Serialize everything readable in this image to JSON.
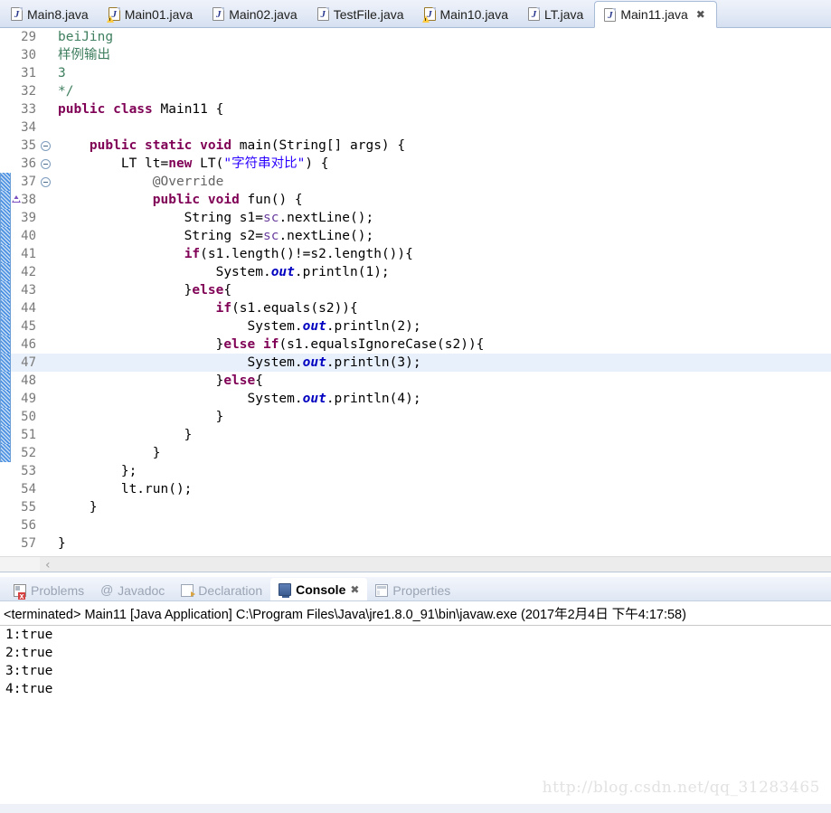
{
  "editor_tabs": [
    {
      "label": "Main8.java",
      "icon": "java-file-icon",
      "active": false,
      "warning": false
    },
    {
      "label": "Main01.java",
      "icon": "java-file-warning-icon",
      "active": false,
      "warning": true
    },
    {
      "label": "Main02.java",
      "icon": "java-file-icon",
      "active": false,
      "warning": false
    },
    {
      "label": "TestFile.java",
      "icon": "java-file-icon",
      "active": false,
      "warning": false
    },
    {
      "label": "Main10.java",
      "icon": "java-file-warning-icon",
      "active": false,
      "warning": true
    },
    {
      "label": "LT.java",
      "icon": "java-file-icon",
      "active": false,
      "warning": false
    },
    {
      "label": "Main11.java",
      "icon": "java-file-icon",
      "active": true,
      "warning": false,
      "close_glyph": "✖"
    }
  ],
  "code": {
    "lines": [
      {
        "no": "29",
        "indent": 0,
        "changed": false,
        "fold": false,
        "current": false,
        "tokens": [
          {
            "t": "beiJing",
            "c": "cmt"
          }
        ]
      },
      {
        "no": "30",
        "indent": 0,
        "changed": false,
        "fold": false,
        "current": false,
        "tokens": [
          {
            "t": "样例输出",
            "c": "cmt"
          }
        ]
      },
      {
        "no": "31",
        "indent": 0,
        "changed": false,
        "fold": false,
        "current": false,
        "tokens": [
          {
            "t": "3",
            "c": "cmt"
          }
        ]
      },
      {
        "no": "32",
        "indent": 0,
        "changed": false,
        "fold": false,
        "current": false,
        "tokens": [
          {
            "t": "*/",
            "c": "cmt"
          }
        ]
      },
      {
        "no": "33",
        "indent": 0,
        "changed": false,
        "fold": false,
        "current": false,
        "tokens": [
          {
            "t": "public class ",
            "c": "kw"
          },
          {
            "t": "Main11 {",
            "c": ""
          }
        ]
      },
      {
        "no": "34",
        "indent": 0,
        "changed": false,
        "fold": false,
        "current": false,
        "tokens": []
      },
      {
        "no": "35",
        "indent": 0,
        "changed": false,
        "fold": true,
        "current": false,
        "tokens": [
          {
            "t": "    ",
            "c": ""
          },
          {
            "t": "public static void ",
            "c": "kw"
          },
          {
            "t": "main(String[] args) {",
            "c": ""
          }
        ]
      },
      {
        "no": "36",
        "indent": 0,
        "changed": false,
        "fold": true,
        "current": false,
        "tokens": [
          {
            "t": "        LT lt=",
            "c": ""
          },
          {
            "t": "new ",
            "c": "kw"
          },
          {
            "t": "LT(",
            "c": ""
          },
          {
            "t": "\"字符串对比\"",
            "c": "str"
          },
          {
            "t": ") {",
            "c": ""
          }
        ]
      },
      {
        "no": "37",
        "indent": 0,
        "changed": true,
        "fold": true,
        "current": false,
        "tokens": [
          {
            "t": "            ",
            "c": ""
          },
          {
            "t": "@Override",
            "c": "ann"
          }
        ]
      },
      {
        "no": "38",
        "indent": 0,
        "changed": true,
        "fold": false,
        "current": false,
        "override": true,
        "tokens": [
          {
            "t": "            ",
            "c": ""
          },
          {
            "t": "public void ",
            "c": "kw"
          },
          {
            "t": "fun() {",
            "c": ""
          }
        ]
      },
      {
        "no": "39",
        "indent": 0,
        "changed": true,
        "fold": false,
        "current": false,
        "tokens": [
          {
            "t": "                String s1=",
            "c": ""
          },
          {
            "t": "sc",
            "c": "loc"
          },
          {
            "t": ".nextLine();",
            "c": ""
          }
        ]
      },
      {
        "no": "40",
        "indent": 0,
        "changed": true,
        "fold": false,
        "current": false,
        "tokens": [
          {
            "t": "                String s2=",
            "c": ""
          },
          {
            "t": "sc",
            "c": "loc"
          },
          {
            "t": ".nextLine();",
            "c": ""
          }
        ]
      },
      {
        "no": "41",
        "indent": 0,
        "changed": true,
        "fold": false,
        "current": false,
        "tokens": [
          {
            "t": "                ",
            "c": ""
          },
          {
            "t": "if",
            "c": "kw"
          },
          {
            "t": "(s1.length()!=s2.length()){",
            "c": ""
          }
        ]
      },
      {
        "no": "42",
        "indent": 0,
        "changed": true,
        "fold": false,
        "current": false,
        "tokens": [
          {
            "t": "                    System.",
            "c": ""
          },
          {
            "t": "out",
            "c": "fld"
          },
          {
            "t": ".println(1);",
            "c": ""
          }
        ]
      },
      {
        "no": "43",
        "indent": 0,
        "changed": true,
        "fold": false,
        "current": false,
        "tokens": [
          {
            "t": "                }",
            "c": ""
          },
          {
            "t": "else",
            "c": "kw"
          },
          {
            "t": "{",
            "c": ""
          }
        ]
      },
      {
        "no": "44",
        "indent": 0,
        "changed": true,
        "fold": false,
        "current": false,
        "tokens": [
          {
            "t": "                    ",
            "c": ""
          },
          {
            "t": "if",
            "c": "kw"
          },
          {
            "t": "(s1.equals(s2)){",
            "c": ""
          }
        ]
      },
      {
        "no": "45",
        "indent": 0,
        "changed": true,
        "fold": false,
        "current": false,
        "tokens": [
          {
            "t": "                        System.",
            "c": ""
          },
          {
            "t": "out",
            "c": "fld"
          },
          {
            "t": ".println(2);",
            "c": ""
          }
        ]
      },
      {
        "no": "46",
        "indent": 0,
        "changed": true,
        "fold": false,
        "current": false,
        "tokens": [
          {
            "t": "                    }",
            "c": ""
          },
          {
            "t": "else if",
            "c": "kw"
          },
          {
            "t": "(s1.equalsIgnoreCase(s2)){",
            "c": ""
          }
        ]
      },
      {
        "no": "47",
        "indent": 0,
        "changed": true,
        "fold": false,
        "current": true,
        "tokens": [
          {
            "t": "                        System.",
            "c": ""
          },
          {
            "t": "out",
            "c": "fld"
          },
          {
            "t": ".println(3);",
            "c": ""
          }
        ]
      },
      {
        "no": "48",
        "indent": 0,
        "changed": true,
        "fold": false,
        "current": false,
        "tokens": [
          {
            "t": "                    }",
            "c": ""
          },
          {
            "t": "else",
            "c": "kw"
          },
          {
            "t": "{",
            "c": ""
          }
        ]
      },
      {
        "no": "49",
        "indent": 0,
        "changed": true,
        "fold": false,
        "current": false,
        "tokens": [
          {
            "t": "                        System.",
            "c": ""
          },
          {
            "t": "out",
            "c": "fld"
          },
          {
            "t": ".println(4);",
            "c": ""
          }
        ]
      },
      {
        "no": "50",
        "indent": 0,
        "changed": true,
        "fold": false,
        "current": false,
        "tokens": [
          {
            "t": "                    }",
            "c": ""
          }
        ]
      },
      {
        "no": "51",
        "indent": 0,
        "changed": true,
        "fold": false,
        "current": false,
        "tokens": [
          {
            "t": "                }",
            "c": ""
          }
        ]
      },
      {
        "no": "52",
        "indent": 0,
        "changed": true,
        "fold": false,
        "current": false,
        "tokens": [
          {
            "t": "            }",
            "c": ""
          }
        ]
      },
      {
        "no": "53",
        "indent": 0,
        "changed": false,
        "fold": false,
        "current": false,
        "tokens": [
          {
            "t": "        };",
            "c": ""
          }
        ]
      },
      {
        "no": "54",
        "indent": 0,
        "changed": false,
        "fold": false,
        "current": false,
        "tokens": [
          {
            "t": "        lt.run();",
            "c": ""
          }
        ]
      },
      {
        "no": "55",
        "indent": 0,
        "changed": false,
        "fold": false,
        "current": false,
        "tokens": [
          {
            "t": "    }",
            "c": ""
          }
        ]
      },
      {
        "no": "56",
        "indent": 0,
        "changed": false,
        "fold": false,
        "current": false,
        "tokens": []
      },
      {
        "no": "57",
        "indent": 0,
        "changed": false,
        "fold": false,
        "current": false,
        "tokens": [
          {
            "t": "}",
            "c": ""
          }
        ]
      }
    ]
  },
  "editor_scroll": {
    "left_arrow_glyph": "‹"
  },
  "view_tabs": [
    {
      "label": "Problems",
      "icon": "problems-icon",
      "active": false
    },
    {
      "label": "Javadoc",
      "icon": "javadoc-icon",
      "active": false
    },
    {
      "label": "Declaration",
      "icon": "declaration-icon",
      "active": false
    },
    {
      "label": "Console",
      "icon": "console-icon",
      "active": true,
      "close_glyph": "✖"
    },
    {
      "label": "Properties",
      "icon": "properties-icon",
      "active": false
    }
  ],
  "console": {
    "terminated_line": "<terminated> Main11 [Java Application] C:\\Program Files\\Java\\jre1.8.0_91\\bin\\javaw.exe (2017年2月4日 下午4:17:58)",
    "output": [
      "1:true",
      "2:true",
      "3:true",
      "4:true"
    ]
  },
  "watermark": "http://blog.csdn.net/qq_31283465",
  "colors": {
    "keyword": "#7f0055",
    "comment": "#3f7f5f",
    "string": "#2a00ff",
    "annotation": "#646464",
    "static_field": "#0000c0",
    "current_line_bg": "#e8f0fb",
    "tab_bar_bg": "#e3eaf6"
  }
}
